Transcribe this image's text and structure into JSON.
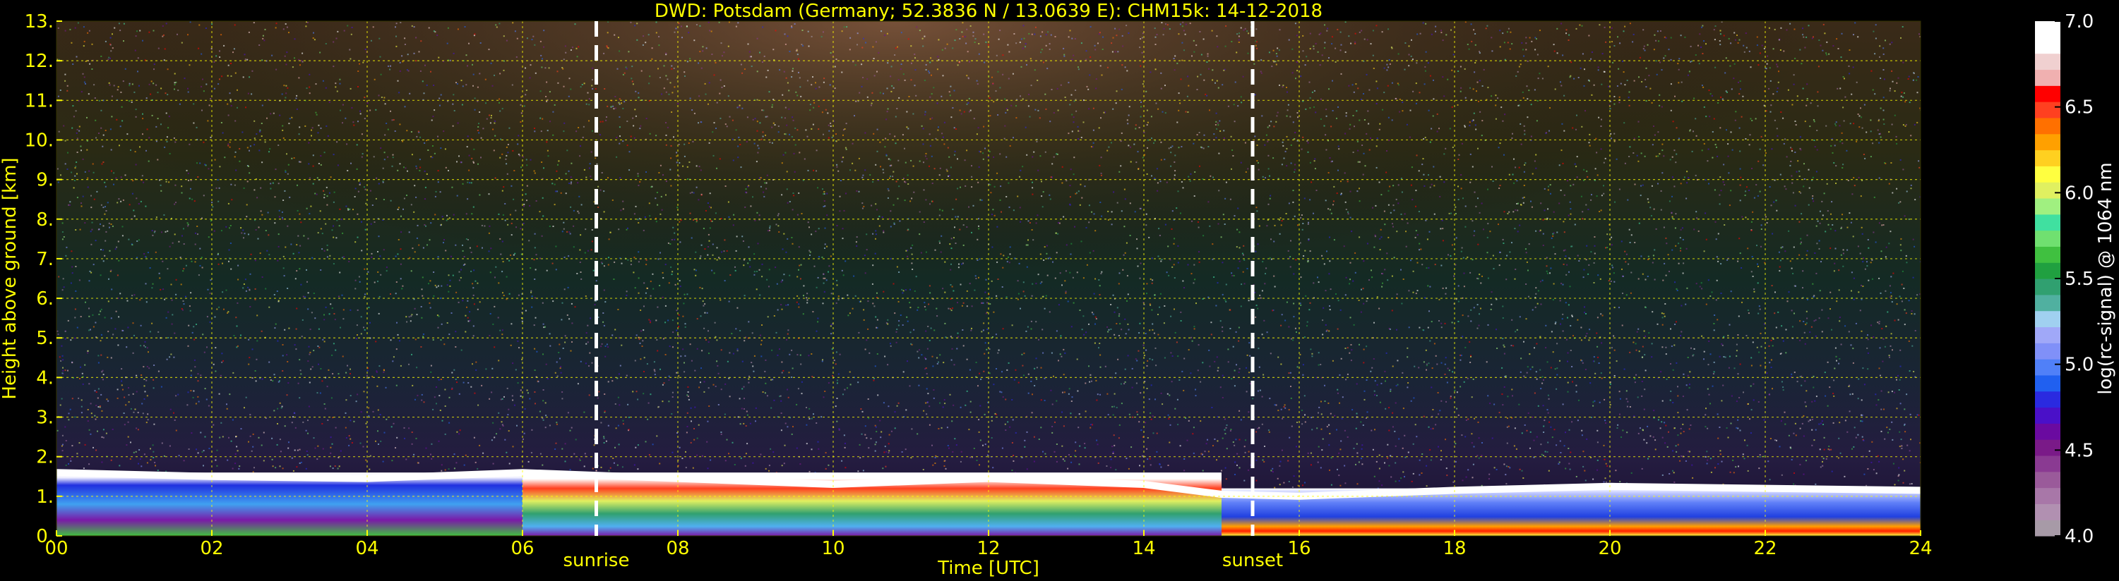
{
  "chart_data": {
    "type": "heatmap",
    "title": "DWD: Potsdam (Germany; 52.3836 N / 13.0639 E):    CHM15k: 14-12-2018",
    "xlabel": "Time [UTC]",
    "ylabel": "Height above ground [km]",
    "xlim": [
      0,
      24
    ],
    "ylim": [
      0,
      13
    ],
    "x_ticks": [
      0,
      2,
      4,
      6,
      8,
      10,
      12,
      14,
      16,
      18,
      20,
      22,
      24
    ],
    "x_tick_labels": [
      "00",
      "02",
      "04",
      "06",
      "08",
      "10",
      "12",
      "14",
      "16",
      "18",
      "20",
      "22",
      "24"
    ],
    "y_ticks": [
      0,
      1,
      2,
      3,
      4,
      5,
      6,
      7,
      8,
      9,
      10,
      11,
      12,
      13
    ],
    "y_tick_labels": [
      "0.",
      "1.",
      "2.",
      "3.",
      "4.",
      "5.",
      "6.",
      "7.",
      "8.",
      "9.",
      "10.",
      "11.",
      "12.",
      "13."
    ],
    "grid": true,
    "annotations": [
      {
        "x": 6.95,
        "text": "sunrise"
      },
      {
        "x": 15.4,
        "text": "sunset"
      }
    ],
    "colorbar": {
      "label": "log(rc-signal) @ 1064 nm",
      "range": [
        4.0,
        7.0
      ],
      "ticks": [
        4.0,
        4.5,
        5.0,
        5.5,
        6.0,
        6.5,
        7.0
      ],
      "tick_labels": [
        "4.0",
        "4.5",
        "5.0",
        "5.5",
        "6.0",
        "6.5",
        "7.0"
      ],
      "colors": [
        "#a79aa7",
        "#b190b1",
        "#a877a8",
        "#9a5a9a",
        "#8a3a92",
        "#7a1a88",
        "#6a0aa0",
        "#4a10c8",
        "#2a2ae0",
        "#2060f0",
        "#5080f8",
        "#8090f8",
        "#a0a8f8",
        "#a0d0f0",
        "#50b0a0",
        "#30a070",
        "#20a040",
        "#40c040",
        "#70e070",
        "#40e0a0",
        "#a0f080",
        "#e0f060",
        "#ffff40",
        "#ffd020",
        "#ffa000",
        "#ff7000",
        "#ff4020",
        "#ff0000",
        "#f0b0b0",
        "#f0d0d0",
        "#ffffff",
        "#ffffff"
      ]
    },
    "layer_regions": [
      {
        "x": [
          0,
          6
        ],
        "y": [
          0,
          1.6
        ],
        "signal": 4.6
      },
      {
        "x": [
          6,
          15
        ],
        "y": [
          0,
          1.6
        ],
        "signal": 5.6
      },
      {
        "x": [
          15,
          24
        ],
        "y": [
          0,
          1.2
        ],
        "signal": 4.9
      }
    ],
    "cloud_top_km": [
      [
        0,
        1.6
      ],
      [
        2,
        1.5
      ],
      [
        4,
        1.45
      ],
      [
        6,
        1.6
      ],
      [
        8,
        1.45
      ],
      [
        10,
        1.3
      ],
      [
        12,
        1.45
      ],
      [
        14,
        1.3
      ],
      [
        15,
        1.05
      ],
      [
        16,
        1.0
      ],
      [
        18,
        1.15
      ],
      [
        20,
        1.25
      ],
      [
        22,
        1.2
      ],
      [
        24,
        1.15
      ]
    ]
  },
  "colors": {
    "background": "#000000",
    "tick_text": "#ffff00",
    "grid": "#ffff00",
    "colorbar_text": "#ffffff"
  }
}
